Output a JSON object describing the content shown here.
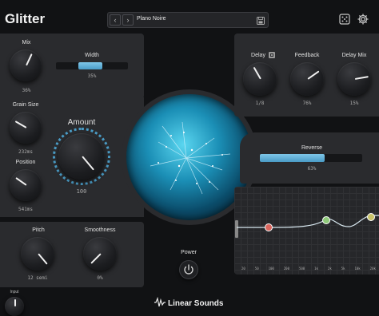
{
  "app": {
    "title": "Glitter"
  },
  "preset": {
    "name": "Plano Noire",
    "prev_icon": "chevron-left-icon",
    "next_icon": "chevron-right-icon",
    "save_icon": "save-icon"
  },
  "header": {
    "dice_icon": "dice-icon",
    "settings_icon": "gear-icon"
  },
  "controls": {
    "mix": {
      "label": "Mix",
      "value": "36%",
      "level": 0.36
    },
    "width": {
      "label": "Width",
      "value": "35%",
      "level": 0.35
    },
    "grain_size": {
      "label": "Grain Size",
      "value": "232ms"
    },
    "position": {
      "label": "Position",
      "value": "541ms"
    },
    "amount": {
      "label": "Amount",
      "value": "100",
      "level": 1.0
    },
    "pitch": {
      "label": "Pitch",
      "value": "12 semi"
    },
    "smoothness": {
      "label": "Smoothness",
      "value": "0%"
    },
    "delay": {
      "label": "Delay",
      "value": "1/8",
      "sync_icon": "sync-icon"
    },
    "feedback": {
      "label": "Feedback",
      "value": "76%"
    },
    "delay_mix": {
      "label": "Delay Mix",
      "value": "15%"
    },
    "reverse": {
      "label": "Reverse",
      "value": "63%",
      "level": 0.63
    },
    "power": {
      "label": "Power",
      "icon": "power-icon"
    },
    "input": {
      "label": "Input"
    }
  },
  "eq": {
    "freq_labels": [
      "20",
      "50",
      "100",
      "200",
      "500",
      "1k",
      "2k",
      "5k",
      "10k",
      "20k"
    ],
    "node_colors": [
      "#d9665e",
      "#8fc97a",
      "#c9c46a"
    ]
  },
  "brand": {
    "name": "Linear Sounds"
  }
}
